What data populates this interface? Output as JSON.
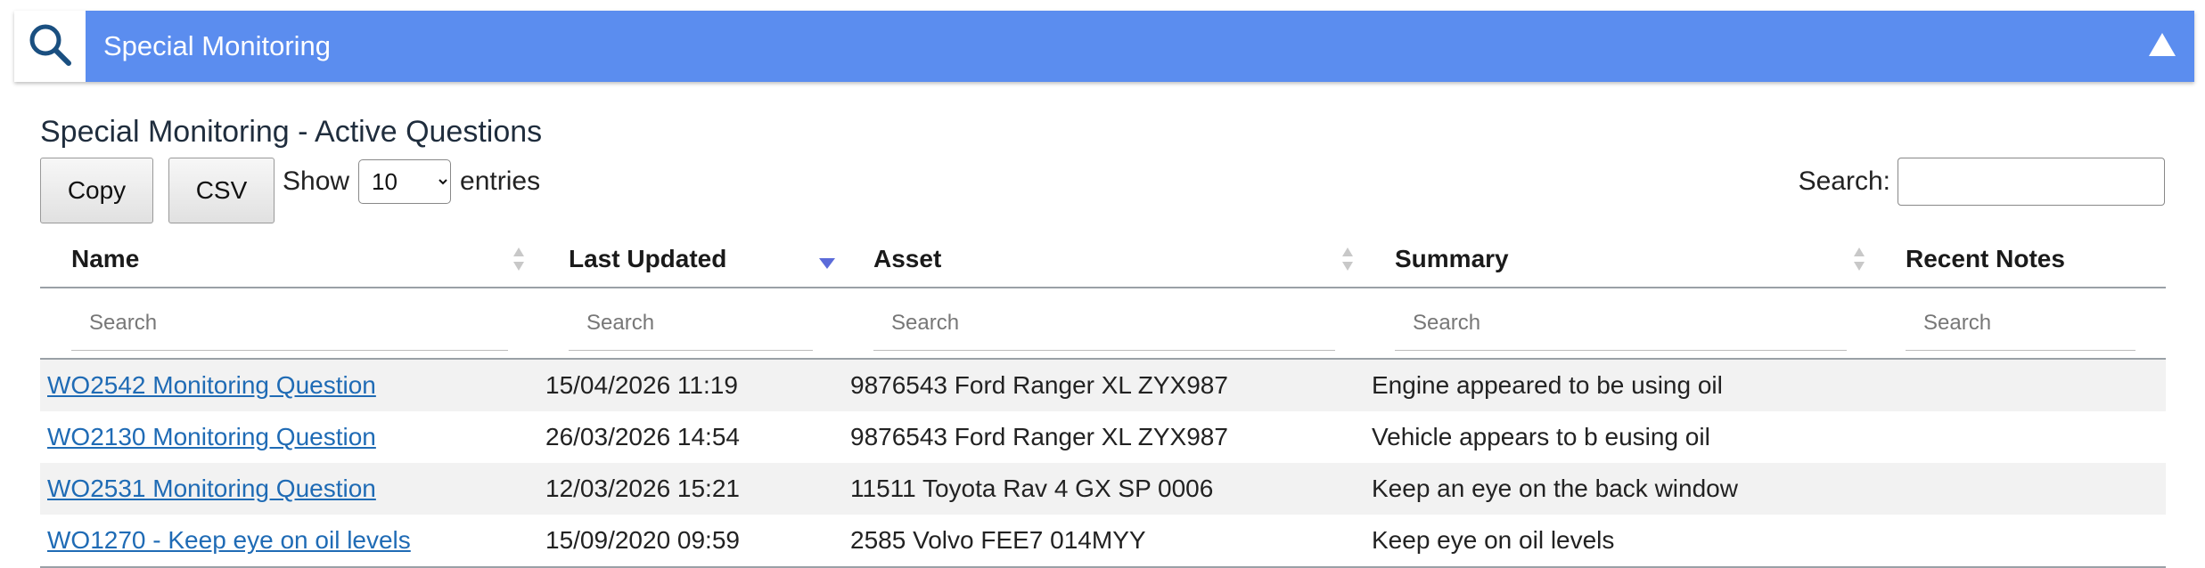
{
  "panel": {
    "title": "Special Monitoring",
    "search_icon": "search-icon",
    "collapse_icon": "triangle-up-icon"
  },
  "section": {
    "title": "Special Monitoring - Active Questions"
  },
  "toolbar": {
    "copy_label": "Copy",
    "csv_label": "CSV",
    "show_label": "Show",
    "entries_label": "entries",
    "page_length": "10",
    "search_label": "Search:",
    "search_value": ""
  },
  "table": {
    "columns": [
      {
        "label": "Name",
        "filter_placeholder": "Search",
        "sort": "none"
      },
      {
        "label": "Last Updated",
        "filter_placeholder": "Search",
        "sort": "desc"
      },
      {
        "label": "Asset",
        "filter_placeholder": "Search",
        "sort": "none"
      },
      {
        "label": "Summary",
        "filter_placeholder": "Search",
        "sort": "none"
      },
      {
        "label": "Recent Notes",
        "filter_placeholder": "Search",
        "sort": "none"
      }
    ],
    "rows": [
      {
        "name": "WO2542 Monitoring Question",
        "updated": "15/04/2026 11:19",
        "asset": "9876543 Ford Ranger XL ZYX987",
        "summary": "Engine appeared to be using oil",
        "notes": ""
      },
      {
        "name": "WO2130 Monitoring Question",
        "updated": "26/03/2026 14:54",
        "asset": "9876543 Ford Ranger XL ZYX987",
        "summary": "Vehicle appears to b eusing oil",
        "notes": ""
      },
      {
        "name": "WO2531 Monitoring Question",
        "updated": "12/03/2026 15:21",
        "asset": "11511 Toyota Rav 4 GX SP 0006",
        "summary": "Keep an eye on the back window",
        "notes": ""
      },
      {
        "name": "WO1270 - Keep eye on oil levels",
        "updated": "15/09/2020 09:59",
        "asset": "2585 Volvo FEE7 014MYY",
        "summary": "Keep eye on oil levels",
        "notes": ""
      }
    ]
  },
  "colors": {
    "header_bar": "#5b8def",
    "link": "#1f6bb5",
    "sort_active": "#5b6bd9",
    "sort_inactive": "#c8c8c8"
  }
}
